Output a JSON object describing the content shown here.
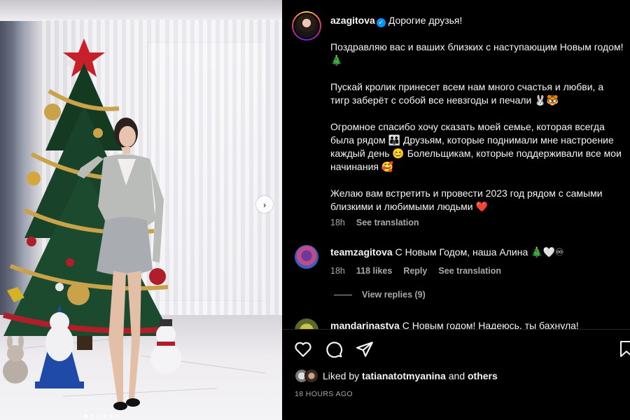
{
  "post": {
    "author": "azagitova",
    "caption_first": "Дорогие друзья!",
    "paragraphs": [
      "Поздравляю вас и ваших близких с наступающим Новым годом! 🎄",
      "Пускай кролик принесет всем нам много счастья и любви, а тигр заберёт с собой все невзгоды и печали 🐰🐯",
      "Огромное спасибо хочу сказать моей семье, которая всегда была рядом 👪 Друзьям, которые поднимали мне настроение каждый день 😊 Болельщикам, которые поддерживали все мои начинания 🥰",
      "Желаю вам встретить и провести 2023 год рядом с самыми близкими и любимыми людьми ❤️"
    ],
    "caption_time": "18h",
    "see_translation": "See translation"
  },
  "comments": [
    {
      "username": "teamzagitova",
      "text": "С Новым Годом, наша Алина 🎄🤍♾",
      "time": "18h",
      "likes": "118 likes",
      "reply": "Reply",
      "see_translation": "See translation",
      "view_replies": "View replies (9)"
    },
    {
      "username": "mandarinastva",
      "text": "С Новым годом! Надеюсь, ты бахнула!"
    }
  ],
  "footer": {
    "liked_by_prefix": "Liked by",
    "liked_by_user": "tatianatotmyanina",
    "liked_by_and": "and",
    "liked_by_others": "others",
    "timestamp": "18 HOURS AGO"
  },
  "carousel": {
    "next_glyph": "›",
    "dot_count": 6,
    "active_dot": 0
  },
  "icons": [
    "heart-icon",
    "comment-icon",
    "share-icon",
    "bookmark-icon",
    "verified-icon",
    "chevron-right-icon"
  ],
  "colors": {
    "background": "#000000",
    "text": "#f5f5f5",
    "muted": "#a8a8a8",
    "verified": "#0095f6"
  }
}
